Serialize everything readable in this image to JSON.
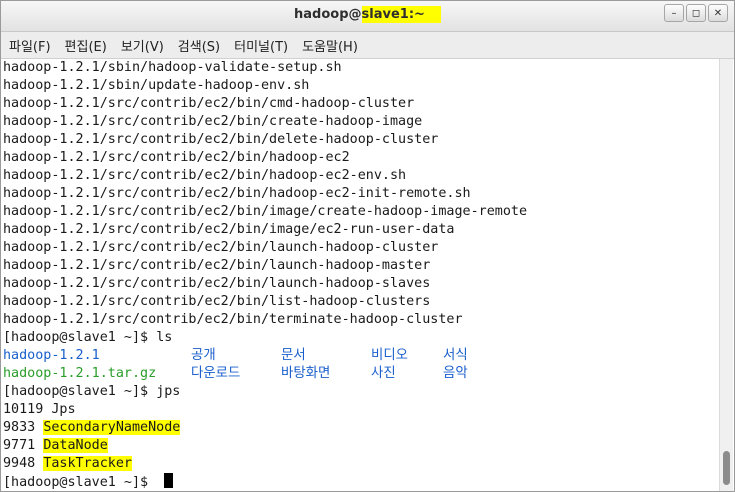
{
  "window": {
    "title_user": "hadoop@",
    "title_host": "slave1:~",
    "minimize": "–",
    "maximize": "◻",
    "close": "✕"
  },
  "menu": [
    "파일(F)",
    "편집(E)",
    "보기(V)",
    "검색(S)",
    "터미널(T)",
    "도움말(H)"
  ],
  "terminal": {
    "find_output": [
      "hadoop-1.2.1/sbin/hadoop-validate-setup.sh",
      "hadoop-1.2.1/sbin/update-hadoop-env.sh",
      "hadoop-1.2.1/src/contrib/ec2/bin/cmd-hadoop-cluster",
      "hadoop-1.2.1/src/contrib/ec2/bin/create-hadoop-image",
      "hadoop-1.2.1/src/contrib/ec2/bin/delete-hadoop-cluster",
      "hadoop-1.2.1/src/contrib/ec2/bin/hadoop-ec2",
      "hadoop-1.2.1/src/contrib/ec2/bin/hadoop-ec2-env.sh",
      "hadoop-1.2.1/src/contrib/ec2/bin/hadoop-ec2-init-remote.sh",
      "hadoop-1.2.1/src/contrib/ec2/bin/image/create-hadoop-image-remote",
      "hadoop-1.2.1/src/contrib/ec2/bin/image/ec2-run-user-data",
      "hadoop-1.2.1/src/contrib/ec2/bin/launch-hadoop-cluster",
      "hadoop-1.2.1/src/contrib/ec2/bin/launch-hadoop-master",
      "hadoop-1.2.1/src/contrib/ec2/bin/launch-hadoop-slaves",
      "hadoop-1.2.1/src/contrib/ec2/bin/list-hadoop-clusters",
      "hadoop-1.2.1/src/contrib/ec2/bin/terminate-hadoop-cluster"
    ],
    "prompt": "[hadoop@slave1 ~]$ ",
    "cmd_ls": "ls",
    "ls_row1": [
      "hadoop-1.2.1",
      "공개",
      "문서",
      "비디오",
      "서식"
    ],
    "ls_row2": [
      "hadoop-1.2.1.tar.gz",
      "다운로드",
      "바탕화면",
      "사진",
      "음악"
    ],
    "cmd_jps": "jps",
    "jps": [
      {
        "pid": "10119",
        "name": "Jps"
      },
      {
        "pid": "9833",
        "name": "SecondaryNameNode"
      },
      {
        "pid": "9771",
        "name": "DataNode"
      },
      {
        "pid": "9948",
        "name": "TaskTracker"
      }
    ]
  },
  "colors": {
    "directory": "#1a5fcc",
    "archive": "#2a9d2a",
    "highlight": "#ffff00"
  }
}
